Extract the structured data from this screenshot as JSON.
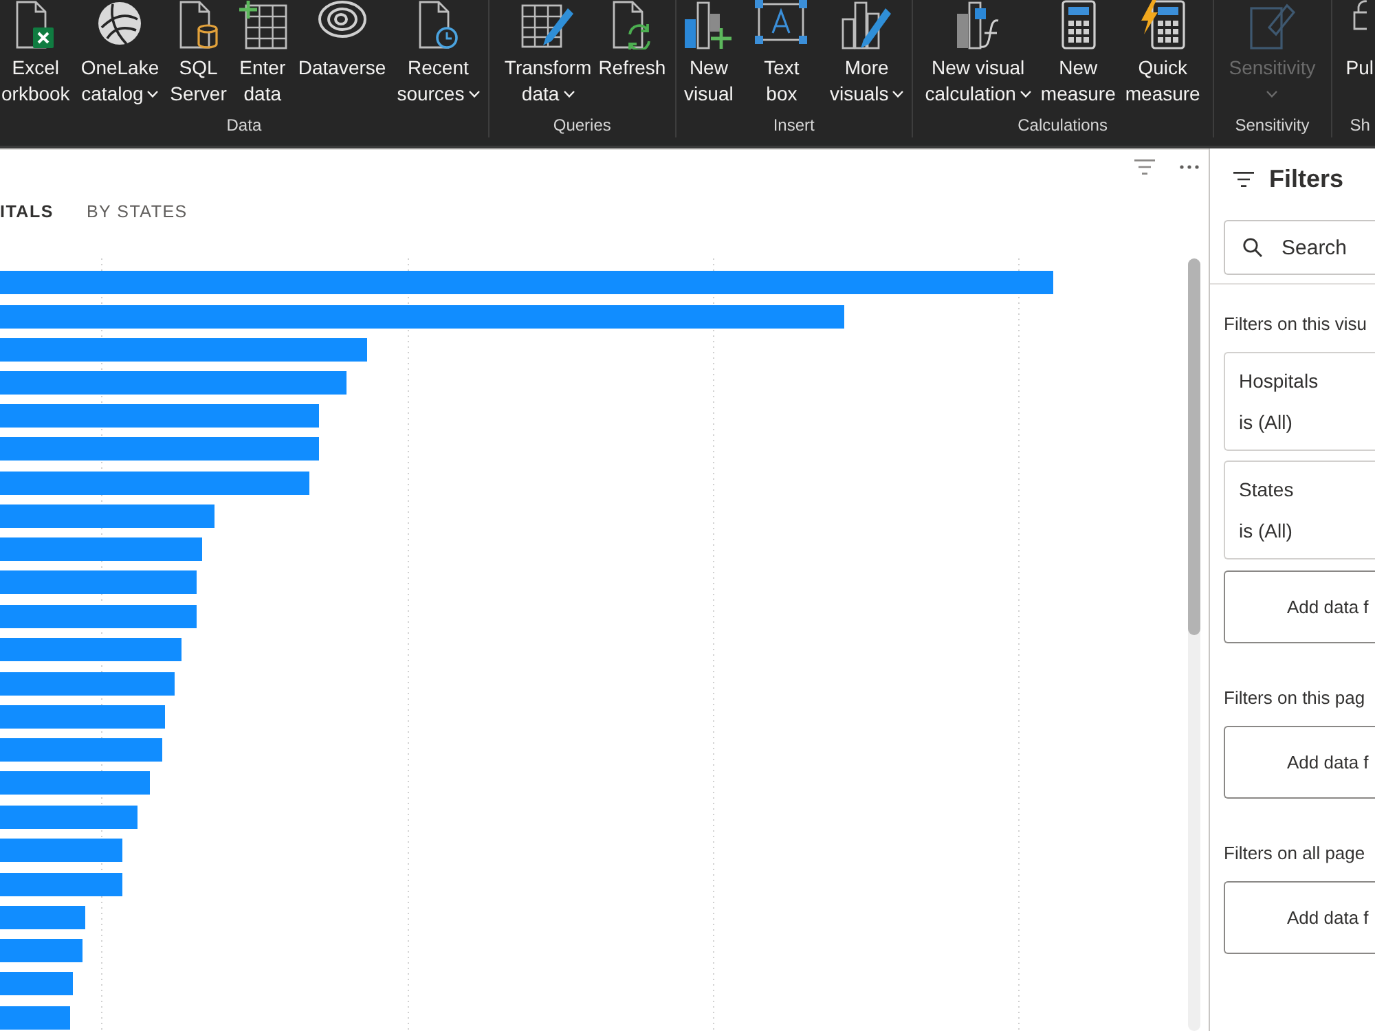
{
  "ribbon": {
    "groups": [
      {
        "label": "Data",
        "items": [
          {
            "lines": [
              "Excel",
              "orkbook"
            ],
            "has_menu": false,
            "disabled": false
          },
          {
            "lines": [
              "OneLake",
              "catalog"
            ],
            "has_menu": true,
            "disabled": false
          },
          {
            "lines": [
              "SQL",
              "Server"
            ],
            "has_menu": false,
            "disabled": false
          },
          {
            "lines": [
              "Enter",
              "data"
            ],
            "has_menu": false,
            "disabled": false
          },
          {
            "lines": [
              "Dataverse"
            ],
            "has_menu": false,
            "disabled": false
          },
          {
            "lines": [
              "Recent",
              "sources"
            ],
            "has_menu": true,
            "disabled": false
          }
        ]
      },
      {
        "label": "Queries",
        "items": [
          {
            "lines": [
              "Transform",
              "data"
            ],
            "has_menu": true,
            "disabled": false
          },
          {
            "lines": [
              "Refresh"
            ],
            "has_menu": false,
            "disabled": false
          }
        ]
      },
      {
        "label": "Insert",
        "items": [
          {
            "lines": [
              "New",
              "visual"
            ],
            "has_menu": false,
            "disabled": false
          },
          {
            "lines": [
              "Text",
              "box"
            ],
            "has_menu": false,
            "disabled": false
          },
          {
            "lines": [
              "More",
              "visuals"
            ],
            "has_menu": true,
            "disabled": false
          }
        ]
      },
      {
        "label": "Calculations",
        "items": [
          {
            "lines": [
              "New visual",
              "calculation"
            ],
            "has_menu": true,
            "disabled": false
          },
          {
            "lines": [
              "New",
              "measure"
            ],
            "has_menu": false,
            "disabled": false
          },
          {
            "lines": [
              "Quick",
              "measure"
            ],
            "has_menu": false,
            "disabled": false
          }
        ]
      },
      {
        "label": "Sensitivity",
        "items": [
          {
            "lines": [
              "Sensitivity"
            ],
            "has_menu": true,
            "disabled": true
          }
        ]
      },
      {
        "label": "Sh",
        "items": [
          {
            "lines": [
              "Pul"
            ],
            "has_menu": false,
            "disabled": false
          }
        ]
      }
    ]
  },
  "visual": {
    "tabs": [
      {
        "label": "ITALS",
        "selected": true
      },
      {
        "label": "BY STATES",
        "selected": false
      }
    ]
  },
  "filters": {
    "title": "Filters",
    "search": {
      "placeholder": "Search"
    },
    "sections": [
      {
        "label": "Filters on this visu",
        "cards": [
          {
            "field": "Hospitals",
            "condition": "is (All)"
          },
          {
            "field": "States",
            "condition": "is (All)"
          }
        ],
        "add": "Add data f"
      },
      {
        "label": "Filters on this pag",
        "add": "Add data f"
      },
      {
        "label": "Filters on all page",
        "add": "Add data f"
      }
    ]
  }
}
